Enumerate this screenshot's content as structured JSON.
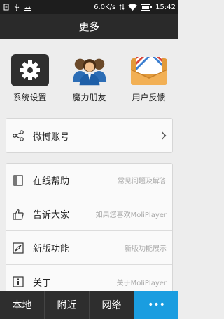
{
  "status_bar": {
    "network_speed": "6.0K/s",
    "time": "15:42"
  },
  "header": {
    "title": "更多"
  },
  "grid": [
    {
      "label": "系统设置",
      "icon": "gear-icon"
    },
    {
      "label": "魔力朋友",
      "icon": "friends-icon"
    },
    {
      "label": "用户反馈",
      "icon": "envelope-icon"
    }
  ],
  "account": {
    "label": "微博账号",
    "icon": "share-icon"
  },
  "menu": [
    {
      "label": "在线帮助",
      "hint": "常见问题及解答",
      "icon": "book-icon"
    },
    {
      "label": "告诉大家",
      "hint": "如果您喜欢MoliPlayer",
      "icon": "thumbs-up-icon"
    },
    {
      "label": "新版功能",
      "hint": "新版功能展示",
      "icon": "compass-icon"
    },
    {
      "label": "关于",
      "hint": "关于MoliPlayer",
      "icon": "info-icon"
    }
  ],
  "tabs": [
    {
      "label": "本地"
    },
    {
      "label": "附近"
    },
    {
      "label": "网络"
    },
    {
      "label": "•••"
    }
  ],
  "colors": {
    "accent": "#1a9de0",
    "title_bar": "#2a2a2a",
    "tab_bar": "#2e2e2e"
  }
}
